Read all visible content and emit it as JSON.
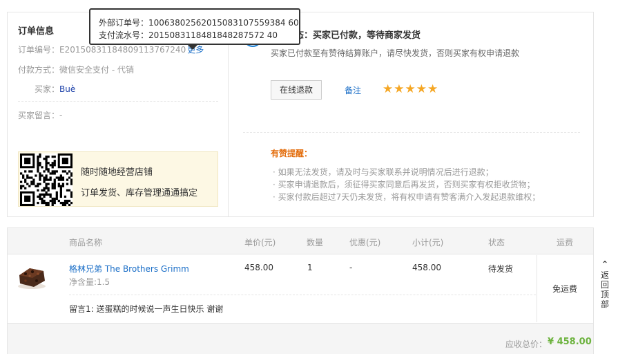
{
  "tooltip": {
    "outer_order": "外部订单号：10063802562015083107559384 60",
    "pay_flow": "支付流水号：2015083118481848287572 40"
  },
  "order_info": {
    "title": "订单信息",
    "order_no_label": "订单编号：",
    "order_no": "E20150831184809113767240",
    "more": "更多",
    "pay_label": "付款方式：",
    "pay_value": "微信安全支付 - 代销",
    "buyer_label": "买家：",
    "buyer_value": "Buè",
    "message_label": "买家留言：",
    "message_value": "-",
    "promo_line1": "随时随地经营店铺",
    "promo_line2": "订单发货、库存管理通通搞定"
  },
  "status": {
    "icon_text": "!",
    "title": "订单状态：买家已付款，等待商家发货",
    "desc": "买家已付款至有赞待结算账户，请尽快发货，否则买家有权申请退款",
    "refund_button": "在线退款",
    "note_link": "备注",
    "stars": "★★★★★",
    "star_rating": 5,
    "tips_title": "有赞提醒：",
    "tips": [
      "· 如果无法发货，请及时与买家联系并说明情况后进行退款；",
      "· 买家申请退款后，须征得买家同意后再发货，否则买家有权拒收货物；",
      "· 买家付款后超过7天仍未发货，将有权申请有赞客满介入发起退款维权；"
    ]
  },
  "table": {
    "headers": {
      "name": "商品名称",
      "price": "单价(元)",
      "qty": "数量",
      "discount": "优惠(元)",
      "subtotal": "小计(元)",
      "status": "状态",
      "shipping": "运费"
    },
    "row": {
      "name": "格林兄弟 The Brothers Grimm",
      "spec": "净含量:1.5",
      "price": "458.00",
      "qty": "1",
      "discount": "-",
      "subtotal": "458.00",
      "status": "待发货",
      "shipping": "免运费",
      "note": "留言1: 送蛋糕的时候说一声生日快乐 谢谢"
    },
    "total_label": "应收总价：",
    "total_value": "¥ 458.00"
  },
  "back_top": {
    "chevron": "⌃",
    "label": "返回顶部"
  },
  "colors": {
    "link": "#1a6ec7",
    "accent_orange": "#e36c0a",
    "star": "#f5a623",
    "total_green": "#6db33f",
    "promo_bg": "#fdf8e4"
  }
}
